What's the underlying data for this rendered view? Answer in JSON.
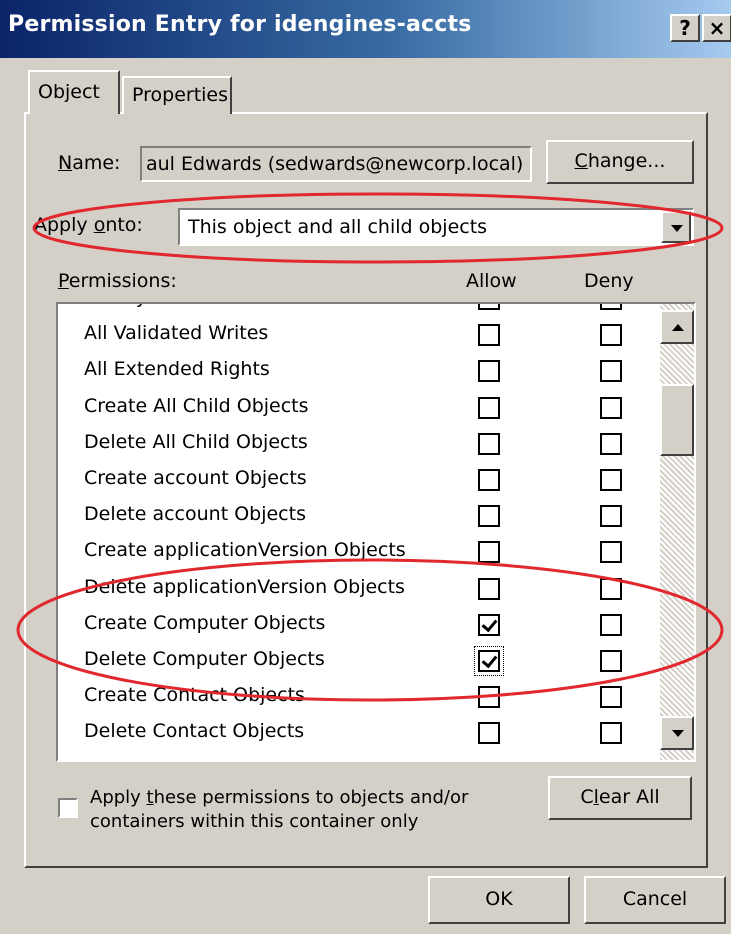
{
  "window": {
    "title": "Permission Entry for idengines-accts",
    "help_glyph": "?",
    "close_glyph": "×"
  },
  "tabs": [
    {
      "label": "Object"
    },
    {
      "label": "Properties"
    }
  ],
  "name_field": {
    "label_underline": "N",
    "label_rest": "ame:",
    "value": "aul Edwards (sedwards@newcorp.local)"
  },
  "change_button": {
    "underline": "C",
    "rest": "hange..."
  },
  "apply_onto": {
    "label_pre": "Apply ",
    "label_underline": "o",
    "label_post": "nto:",
    "value": "This object and all child objects"
  },
  "permissions": {
    "label_underline": "P",
    "label_rest": "ermissions:",
    "allow_header": "Allow",
    "deny_header": "Deny",
    "items": [
      {
        "label": "Modify Owner",
        "allow": false,
        "deny": false
      },
      {
        "label": "All Validated Writes",
        "allow": false,
        "deny": false
      },
      {
        "label": "All Extended Rights",
        "allow": false,
        "deny": false
      },
      {
        "label": "Create All Child Objects",
        "allow": false,
        "deny": false
      },
      {
        "label": "Delete All Child Objects",
        "allow": false,
        "deny": false
      },
      {
        "label": "Create account Objects",
        "allow": false,
        "deny": false
      },
      {
        "label": "Delete account Objects",
        "allow": false,
        "deny": false
      },
      {
        "label": "Create applicationVersion Objects",
        "allow": false,
        "deny": false
      },
      {
        "label": "Delete applicationVersion Objects",
        "allow": false,
        "deny": false
      },
      {
        "label": "Create Computer Objects",
        "allow": true,
        "deny": false
      },
      {
        "label": "Delete Computer Objects",
        "allow": true,
        "deny": false
      },
      {
        "label": "Create Contact Objects",
        "allow": false,
        "deny": false
      },
      {
        "label": "Delete Contact Objects",
        "allow": false,
        "deny": false
      }
    ]
  },
  "apply_container_only": {
    "line1_pre": "Apply ",
    "line1_underline": "t",
    "line1_post": "hese permissions to objects and/or",
    "line2": "containers within this container only",
    "checked": false
  },
  "clear_all_button": {
    "pre": "C",
    "underline": "l",
    "post": "ear All"
  },
  "ok_button": "OK",
  "cancel_button": "Cancel",
  "colors": {
    "title_start": "#0a246a",
    "title_end": "#a6caf0",
    "dialog_bg": "#d4d0c8",
    "annotation": "#e0282e"
  }
}
